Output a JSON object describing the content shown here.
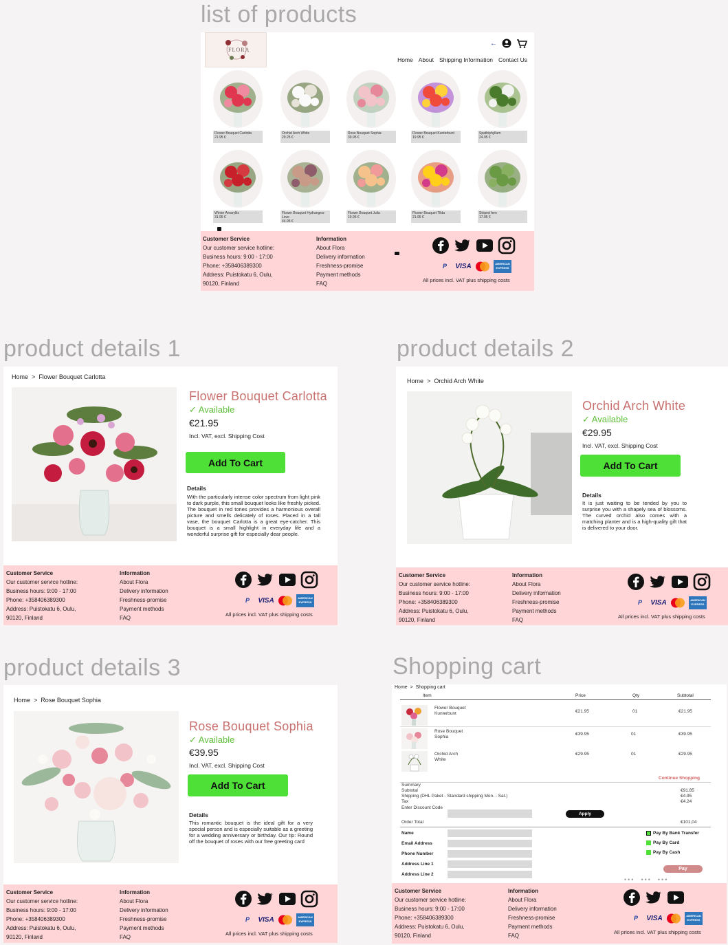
{
  "frames": {
    "list": "list of products",
    "pd1": "product details 1",
    "pd2": "product details 2",
    "pd3": "product details 3",
    "cart": "Shopping cart"
  },
  "colors": {
    "accent_green": "#4ee037",
    "footer_pink": "#ffd5d7",
    "title_rose": "#c8716f"
  },
  "header": {
    "logo_text": "FLORA",
    "nav": [
      "Home",
      "About",
      "Shipping Information",
      "Contact Us"
    ],
    "icons": [
      "back-arrow-icon",
      "account-icon",
      "cart-icon"
    ]
  },
  "products": [
    {
      "name": "Flower Bouquet Carlotta",
      "price": "21.95 €"
    },
    {
      "name": "Orchid Arch White",
      "price": "29.25 €"
    },
    {
      "name": "Rose Bouquet Sophia",
      "price": "39.95 €"
    },
    {
      "name": "Flower Bouquet Kunterbunt",
      "price": "19.95 €"
    },
    {
      "name": "Spathiphyllum",
      "price": "24.95 €"
    },
    {
      "name": "Winter Amaryllis",
      "price": "31.95 €"
    },
    {
      "name": "Flower Bouquet Hydrangea-Love",
      "price": "44.95 €"
    },
    {
      "name": "Flower Bouquet Julia",
      "price": "19.95 €"
    },
    {
      "name": "Flower Bouquet Tilda",
      "price": "21.95 €"
    },
    {
      "name": "Striped fern",
      "price": "17.95 €"
    }
  ],
  "footer": {
    "cs_title": "Customer Service",
    "cs_lines": [
      "Our customer service hotline:",
      "Business hours: 9:00 - 17:00",
      "Phone: +358406389300",
      "Address: Puistokatu 6, Oulu,",
      "90120, Finland"
    ],
    "info_title": "Information",
    "info_lines": [
      "About Flora",
      "Delivery information",
      "Freshness-promise",
      "Payment methods",
      "FAQ"
    ],
    "social_icons": [
      "facebook-icon",
      "twitter-icon",
      "youtube-icon",
      "instagram-icon"
    ],
    "payment_icons": [
      "PayPal",
      "VISA",
      "mastercard",
      "AMERICAN EXPRESS"
    ],
    "note": "All prices incl. VAT plus shipping costs"
  },
  "pd1": {
    "crumb_home": "Home",
    "crumb_sep": ">",
    "crumb_item": "Flower Bouquet Carlotta",
    "title": "Flower Bouquet Carlotta",
    "available": "✓ Available",
    "price": "€21.95",
    "vat": "Incl. VAT, excl. Shipping Cost",
    "button": "Add To Cart",
    "details_h": "Details",
    "details": "With the particularly intense color spectrum from light pink to dark purple, this small bouquet looks like freshly picked. The bouquet in red tones provides a harmonious overall picture and smells delicately of roses. Placed in a tall vase, the bouquet Carlotta is a great eye-catcher. This bouquet is a small highlight in everyday life and a wonderful surprise gift for especially dear people."
  },
  "pd2": {
    "crumb_home": "Home",
    "crumb_sep": ">",
    "crumb_item": "Orchid Arch White",
    "title": "Orchid Arch White",
    "available": "✓ Available",
    "price": "€29.95",
    "vat": "Incl. VAT, excl. Shipping Cost",
    "button": "Add To Cart",
    "details_h": "Details",
    "details": "It is just waiting to be tended by you to surprise you with a shapely sea of blossoms. The curved orchid also comes with a matching planter and is a high-quality gift that is delivered to your door."
  },
  "pd3": {
    "crumb_home": "Home",
    "crumb_sep": ">",
    "crumb_item": "Rose Bouquet Sophia",
    "title": "Rose Bouquet Sophia",
    "available": "✓ Available",
    "price": "€39.95",
    "vat": "Incl. VAT, excl. Shipping Cost",
    "button": "Add To Cart",
    "details_h": "Details",
    "details": "This romantic bouquet is the ideal gift for a very special person and is especially suitable as a greeting for a wedding anniversary or birthday. Our tip: Round off the bouquet of roses with our free greeting card"
  },
  "cart": {
    "crumb_home": "Home",
    "crumb_sep": ">",
    "crumb_item": "Shopping cart",
    "headers": [
      "Item",
      "Price",
      "Qty",
      "Subtotal"
    ],
    "rows": [
      {
        "item": "Flower Bouquet Kunterbunt",
        "price": "€21.95",
        "qty": "01",
        "subtotal": "€21.95"
      },
      {
        "item": "Rose Bouquet Sophia",
        "price": "€39.95",
        "qty": "01",
        "subtotal": "€39.95"
      },
      {
        "item": "Orchid Arch White",
        "price": "€29.95",
        "qty": "01",
        "subtotal": "€29.95"
      }
    ],
    "continue": "Continue Shopping",
    "summary": "Summary",
    "subtotal_label": "Subtotal",
    "subtotal": "€91.85",
    "shipping_label": "Shipping (DHL Paket - Standard shipping Mon. - Sat.)",
    "shipping": "€4.95",
    "tax_label": "Tax",
    "tax": "€4.24",
    "discount_label": "Enter Discount Code",
    "apply": "Apply",
    "total_label": "Order Total",
    "total": "€101,04",
    "fields": [
      "Name",
      "Email Address",
      "Phone Number",
      "Address Line 1",
      "Address Line 2"
    ],
    "pay_options": [
      "Pay By Bank Transfer",
      "Pay By Card",
      "Pay By Cash"
    ],
    "pay_button": "Pay"
  }
}
